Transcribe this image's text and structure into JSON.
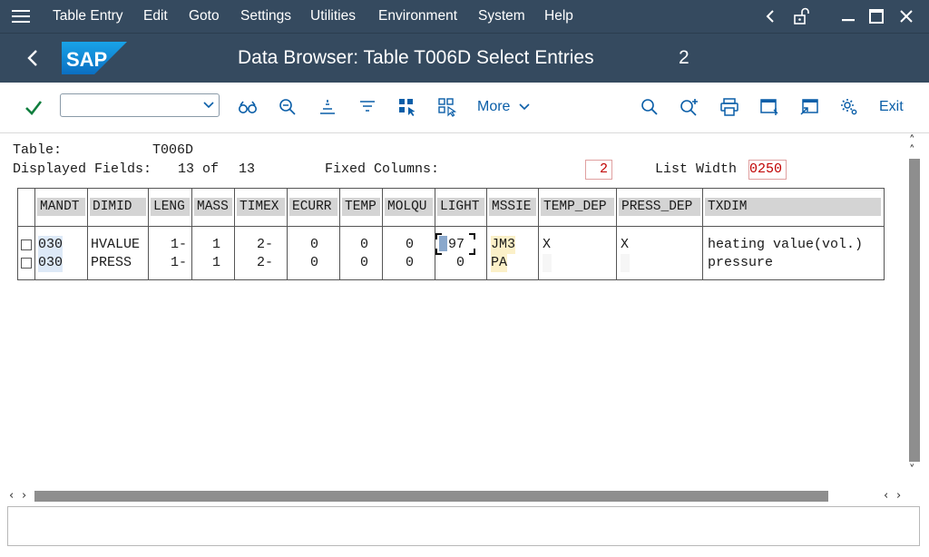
{
  "menu": {
    "items": [
      "Table Entry",
      "Edit",
      "Goto",
      "Settings",
      "Utilities",
      "Environment",
      "System",
      "Help"
    ]
  },
  "window_controls": [
    "back-icon",
    "unlock-icon",
    "minimize-icon",
    "maximize-icon",
    "close-icon"
  ],
  "title": {
    "logo": "SAP",
    "text": "Data Browser: Table T006D Select Entries",
    "count": "2"
  },
  "toolbar": {
    "command_value": "",
    "more_label": "More",
    "exit_label": "Exit"
  },
  "info": {
    "table_label": "Table:",
    "table_value": "T006D",
    "displayed_fields_label": "Displayed Fields:",
    "displayed_fields_count": "13",
    "of_label": "of",
    "displayed_fields_total": "13",
    "fixed_columns_label": "Fixed Columns:",
    "fixed_columns_value": "2",
    "list_width_label": "List Width",
    "list_width_value": "0250"
  },
  "table": {
    "columns": [
      "MANDT",
      "DIMID",
      "LENG",
      "MASS",
      "TIMEX",
      "ECURR",
      "TEMP",
      "MOLQU",
      "LIGHT",
      "MSSIE",
      "TEMP_DEP",
      "PRESS_DEP",
      "TXDIM"
    ],
    "rows": [
      [
        "030",
        "HVALUE",
        "1-",
        "1",
        "2-",
        "0",
        "0",
        "0",
        "97",
        "JM3",
        "X",
        "X",
        "heating value(vol.)"
      ],
      [
        "030",
        "PRESS",
        "1-",
        "1",
        "2-",
        "0",
        "0",
        "0",
        "0",
        "PA",
        "",
        "",
        "pressure"
      ]
    ]
  },
  "colors": {
    "shell": "#354a5f",
    "key_highlight": "#dde9f7",
    "unit_highlight": "#fbf0c8",
    "accent": "#0a5ea8",
    "check": "#107e3e"
  }
}
